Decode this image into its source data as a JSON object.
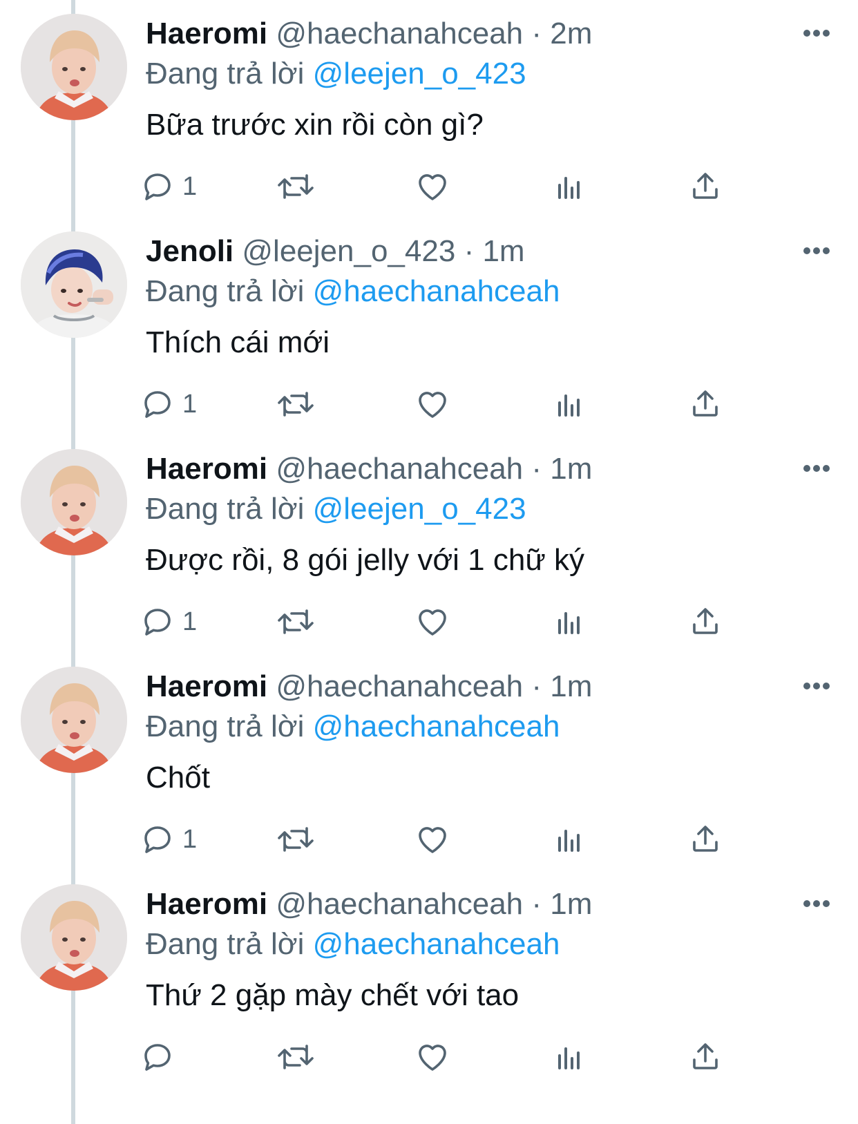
{
  "reply_prefix": "Đang trả lời",
  "tweets": [
    {
      "name": "Haeromi",
      "handle": "@haechanahceah",
      "separator": "·",
      "time": "2m",
      "reply_to": "@leejen_o_423",
      "text": "Bữa trước xin rồi còn gì?",
      "reply_count": "1",
      "avatar": "haeromi-avatar"
    },
    {
      "name": "Jenoli",
      "handle": "@leejen_o_423",
      "separator": "·",
      "time": "1m",
      "reply_to": "@haechanahceah",
      "text": "Thích cái mới",
      "reply_count": "1",
      "avatar": "jenoli-avatar"
    },
    {
      "name": "Haeromi",
      "handle": "@haechanahceah",
      "separator": "·",
      "time": "1m",
      "reply_to": "@leejen_o_423",
      "text": "Được rồi, 8 gói jelly với 1 chữ ký",
      "reply_count": "1",
      "avatar": "haeromi-avatar"
    },
    {
      "name": "Haeromi",
      "handle": "@haechanahceah",
      "separator": "·",
      "time": "1m",
      "reply_to": "@haechanahceah",
      "text": "Chốt",
      "reply_count": "1",
      "avatar": "haeromi-avatar"
    },
    {
      "name": "Haeromi",
      "handle": "@haechanahceah",
      "separator": "·",
      "time": "1m",
      "reply_to": "@haechanahceah",
      "text": "Thứ 2 gặp mày chết với tao",
      "reply_count": "",
      "avatar": "haeromi-avatar"
    }
  ],
  "colors": {
    "text": "#0f1419",
    "secondary": "#536471",
    "link": "#1d9bf0",
    "thread_line": "#cfd9de"
  }
}
